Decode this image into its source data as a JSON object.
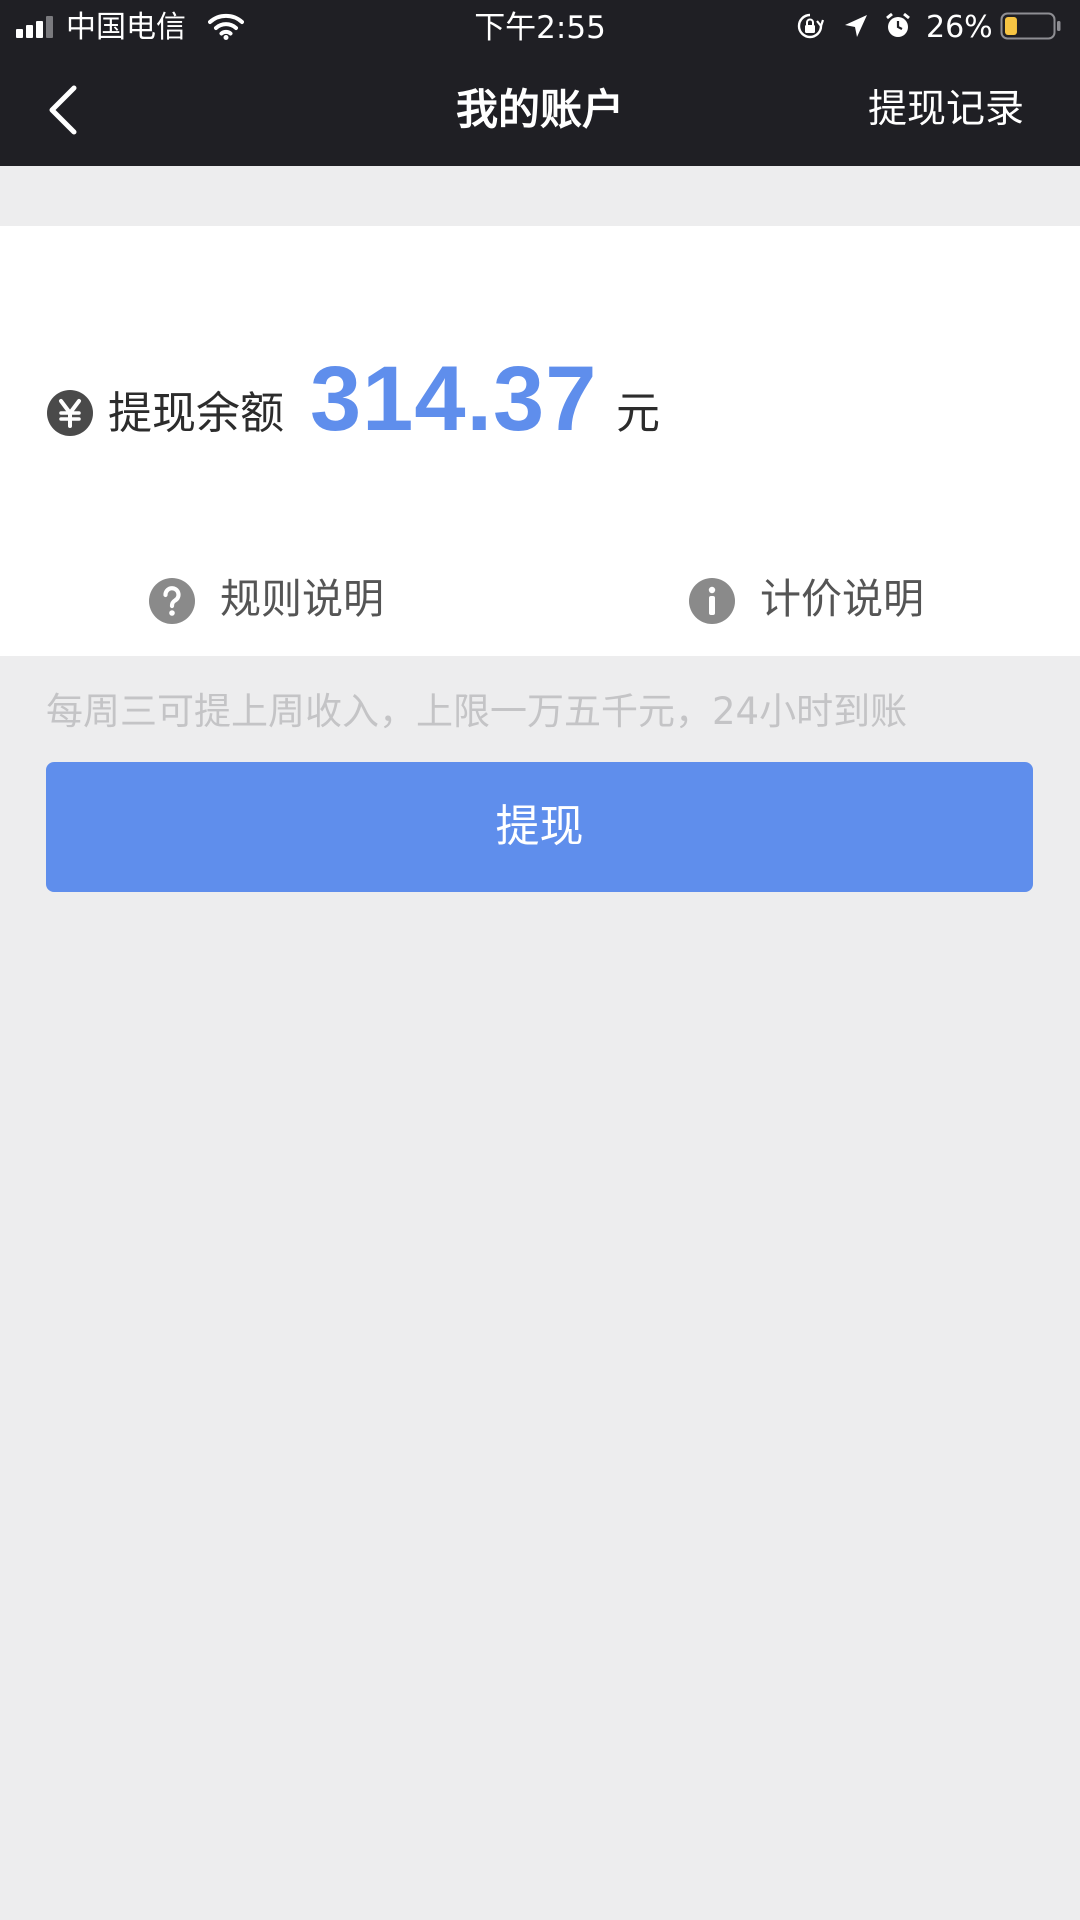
{
  "status_bar": {
    "carrier": "中国电信",
    "time": "下午2:55",
    "battery_percent": "26%",
    "battery_level": 0.26,
    "icons": [
      "signal-icon",
      "wifi-icon",
      "orientation-lock-icon",
      "location-icon",
      "alarm-icon",
      "battery-icon"
    ]
  },
  "nav": {
    "back_icon": "chevron-left-icon",
    "title": "我的账户",
    "right_action": "提现记录"
  },
  "balance": {
    "icon": "yen-icon",
    "label": "提现余额",
    "amount": "314.37",
    "unit": "元"
  },
  "links": {
    "rules": {
      "icon": "question-icon",
      "label": "规则说明"
    },
    "pricing": {
      "icon": "info-icon",
      "label": "计价说明"
    }
  },
  "hint": "每周三可提上周收入，上限一万五千元，24小时到账",
  "withdraw_button": "提现",
  "colors": {
    "header_bg": "#1f1f24",
    "accent": "#5f8eec",
    "page_bg": "#ededee",
    "battery_fill": "#f6c443"
  }
}
